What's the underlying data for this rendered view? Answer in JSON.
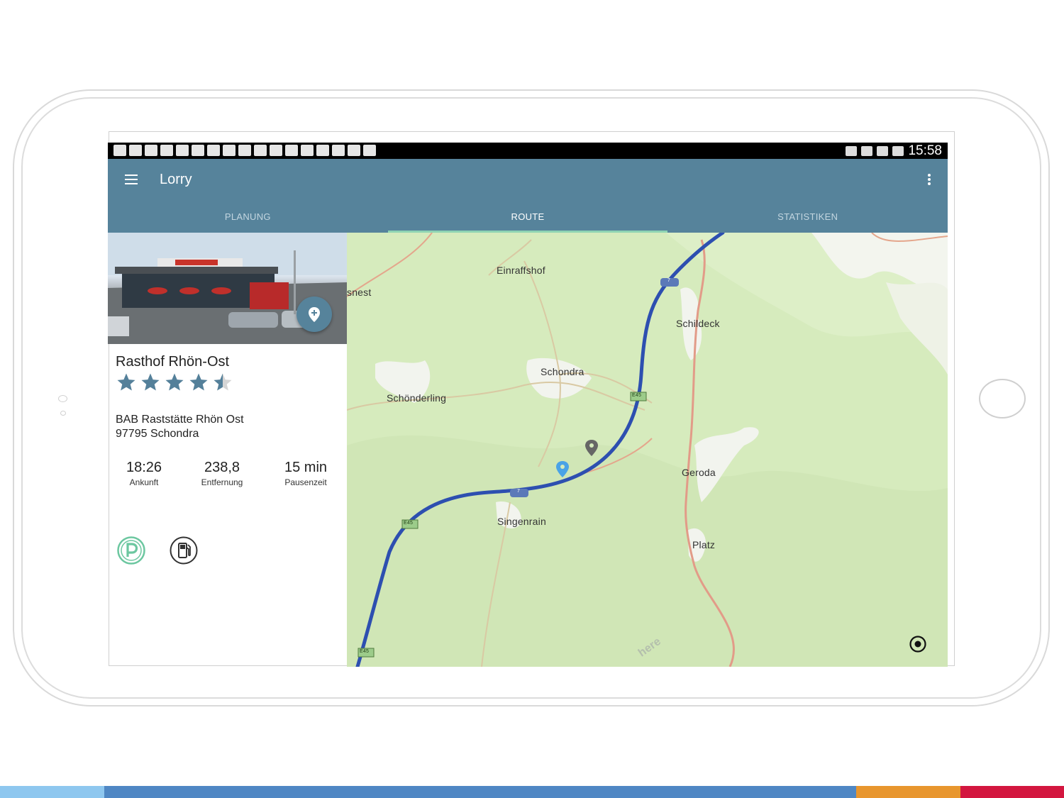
{
  "statusbar": {
    "time": "15:58"
  },
  "appbar": {
    "title": "Lorry",
    "tabs": [
      {
        "label": "PLANUNG",
        "active": false
      },
      {
        "label": "ROUTE",
        "active": true
      },
      {
        "label": "STATISTIKEN",
        "active": false
      }
    ]
  },
  "place": {
    "name": "Rasthof Rhön-Ost",
    "rating": 4.5,
    "rating_max": 5,
    "address_line1": "BAB Raststätte Rhön Ost",
    "address_line2": "97795 Schondra",
    "stats": [
      {
        "value": "18:26",
        "label": "Ankunft"
      },
      {
        "value": "238,8",
        "label": "Entfernung"
      },
      {
        "value": "15 min",
        "label": "Pausenzeit"
      }
    ],
    "amenities": [
      "parking-icon",
      "fuel-icon"
    ]
  },
  "map": {
    "labels": {
      "einraffshof": "Einraffshof",
      "snest": "snest",
      "schildeck": "Schildeck",
      "schondra": "Schondra",
      "schoenderling": "Schönderling",
      "geroda": "Geroda",
      "singenrain": "Singenrain",
      "platz": "Platz"
    },
    "road_shields": {
      "a7": "7",
      "e45": "E45"
    },
    "watermark": "here",
    "route_color": "#2d4fb0",
    "land_color": "#d8ecc0"
  },
  "colors": {
    "appbar": "#56839b",
    "tab_indicator": "#8fd4b3",
    "parking_accent": "#6cc7a0",
    "bottom_bar": [
      "#8ec7ef",
      "#4f87c4",
      "#e8962e",
      "#d3163f"
    ]
  }
}
